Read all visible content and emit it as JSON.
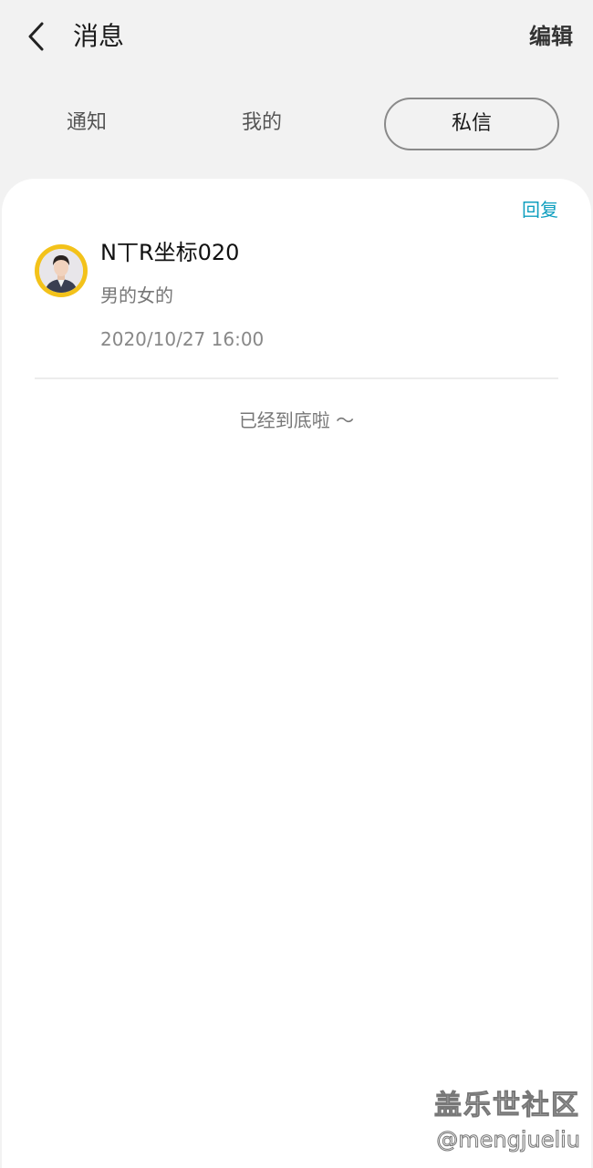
{
  "header": {
    "title": "消息",
    "edit_label": "编辑",
    "back_icon": "chevron-left-icon"
  },
  "tabs": [
    {
      "label": "通知",
      "active": false
    },
    {
      "label": "我的",
      "active": false
    },
    {
      "label": "私信",
      "active": true
    }
  ],
  "messages": [
    {
      "reply_label": "回复",
      "name": "N丅R坐标020",
      "text": "男的女的",
      "time": "2020/10/27 16:00"
    }
  ],
  "end_text": "已经到底啦 〜",
  "watermark": {
    "brand": "盖乐世社区",
    "user": "@mengjueliu"
  },
  "colors": {
    "background": "#f2f2f2",
    "card": "#ffffff",
    "reply": "#0f9fbf",
    "avatar_ring": "#f3c21a"
  }
}
